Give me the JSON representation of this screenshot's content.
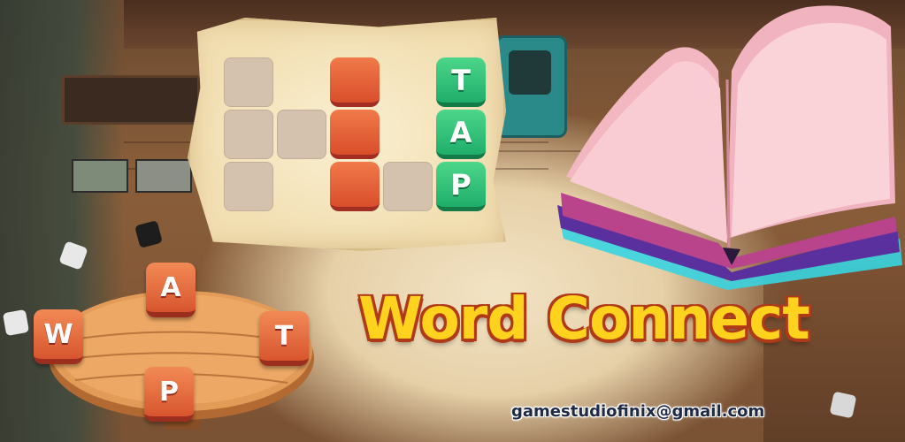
{
  "board": {
    "letters": [
      "T",
      "A",
      "P"
    ]
  },
  "table_tiles": [
    "A",
    "W",
    "T",
    "P"
  ],
  "title": "Word Connect",
  "email": "gamestudiofinix@gmail.com",
  "colors": {
    "title_fill": "#ffd21e",
    "title_outline": "#b03a18",
    "tile_orange": "#e0603a",
    "tile_green": "#2cc07a",
    "empty_cell": "#d4c1ae",
    "board_paper": "#f2dfb2",
    "book_pages": "#f6c9cf",
    "book_cover": "#6b3fb0"
  }
}
